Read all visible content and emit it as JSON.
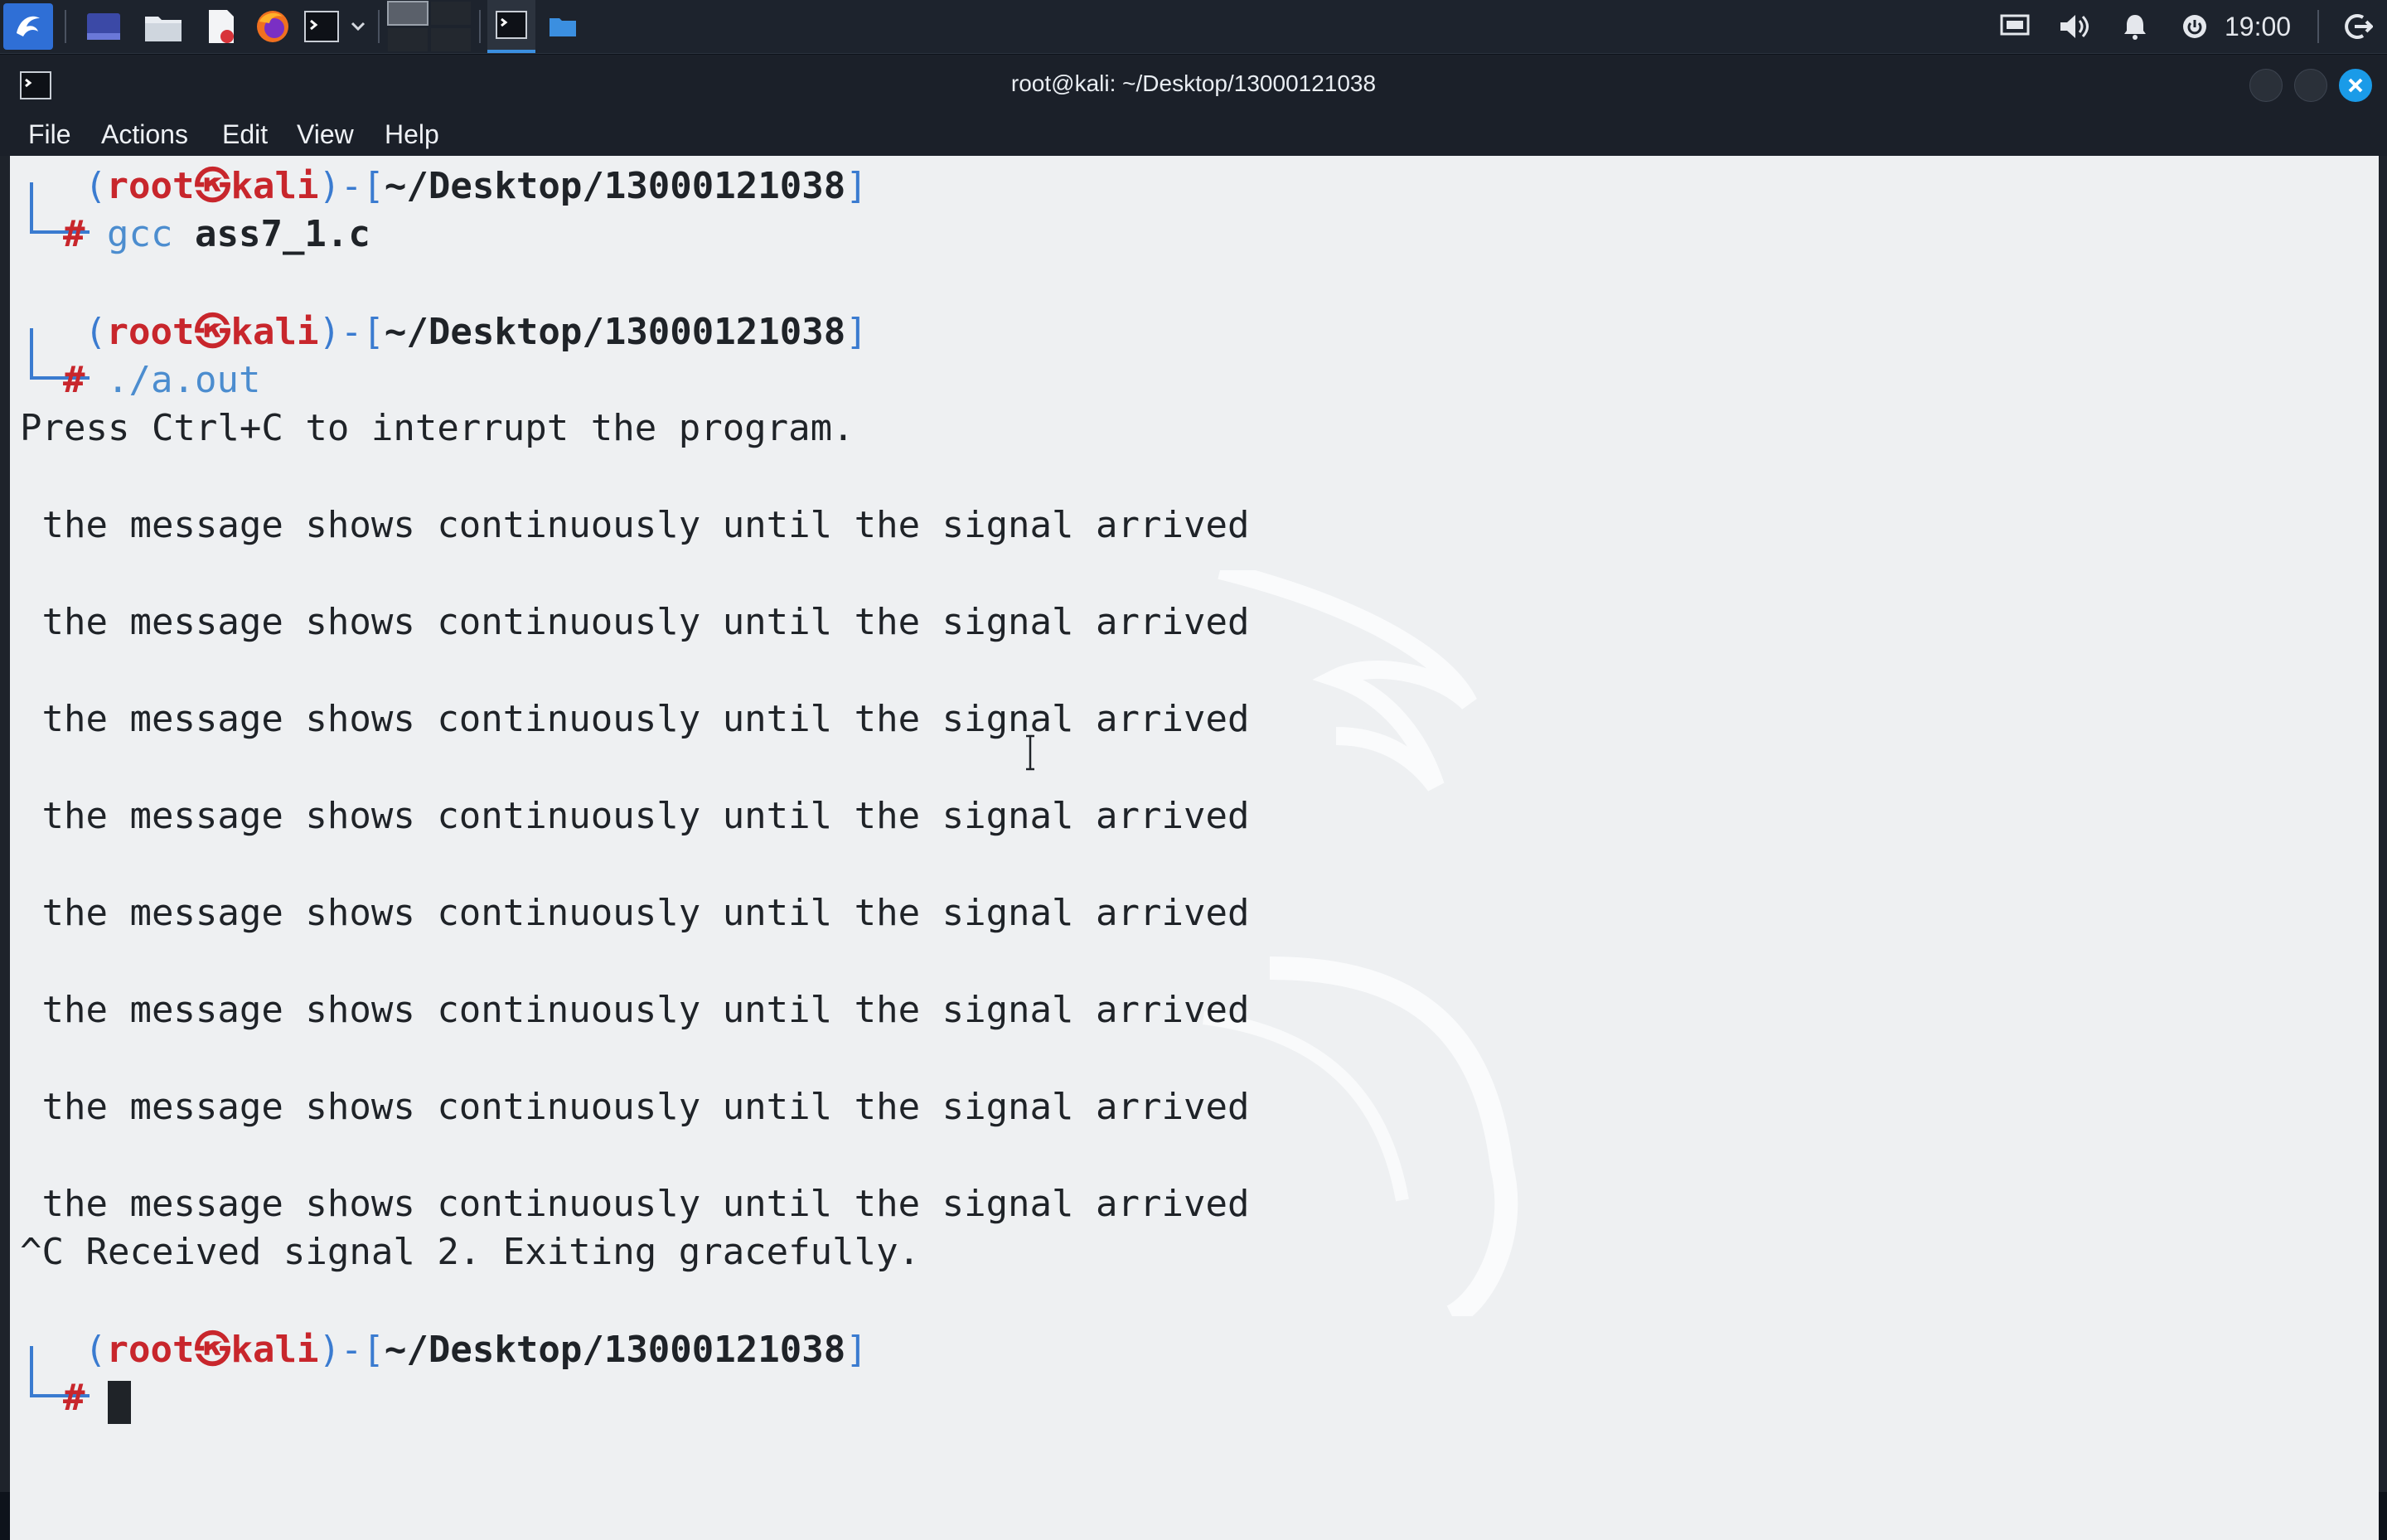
{
  "taskbar": {
    "icons": [
      "kali-menu-icon",
      "workspace-icon",
      "file-manager-icon",
      "text-editor-icon",
      "firefox-icon",
      "terminal-icon",
      "chevron-down-icon",
      "workspace-pager-icon",
      "terminal-window-icon",
      "folder-window-icon"
    ],
    "tray_icons": [
      "screen-icon",
      "volume-icon",
      "notification-bell-icon",
      "power-icon",
      "logout-icon"
    ],
    "clock": "19:00"
  },
  "window": {
    "title": "root@kali: ~/Desktop/13000121038",
    "menu": [
      "File",
      "Actions",
      "Edit",
      "View",
      "Help"
    ]
  },
  "terminal": {
    "prompt": {
      "open": "(",
      "user": "root",
      "at": "㉿",
      "host": "kali",
      "mid": ")-[",
      "path": "~/Desktop/13000121038",
      "close": "]",
      "hash": "#"
    },
    "cmd1": "gcc",
    "cmd1_arg": "ass7_1.c",
    "cmd2": "./a.out",
    "press_msg": "Press Ctrl+C to interrupt the program.",
    "messages": [
      " the message shows continuously until the signal arrived",
      " the message shows continuously until the signal arrived",
      " the message shows continuously until the signal arrived",
      " the message shows continuously until the signal arrived",
      " the message shows continuously until the signal arrived",
      " the message shows continuously until the signal arrived",
      " the message shows continuously until the signal arrived",
      " the message shows continuously until the signal arrived"
    ],
    "exit_msg": "^C Received signal 2. Exiting gracefully."
  },
  "colors": {
    "accent_blue": "#3a7bd0",
    "prompt_red": "#c8262c",
    "terminal_bg": "#eef0f2"
  }
}
